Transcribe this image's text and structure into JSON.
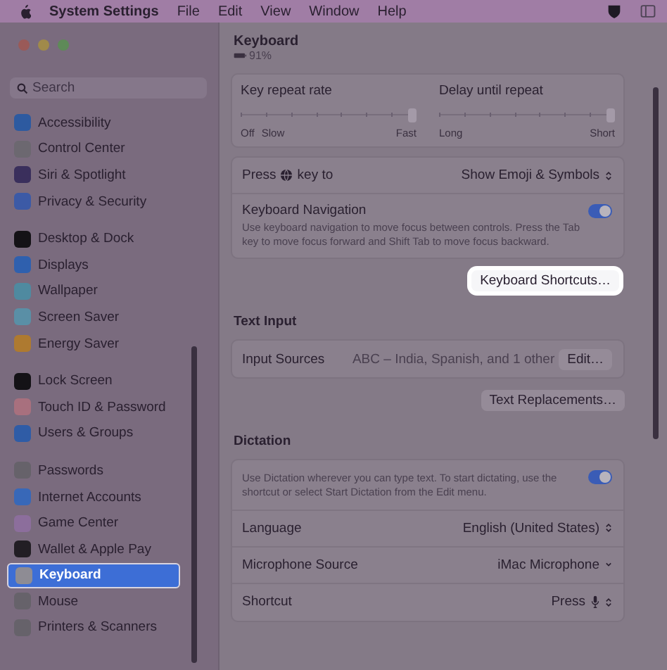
{
  "menu_bar": {
    "app_name": "System Settings",
    "menus": [
      "File",
      "Edit",
      "View",
      "Window",
      "Help"
    ]
  },
  "sidebar": {
    "search": {
      "placeholder": "Search"
    },
    "groups": [
      {
        "items": [
          {
            "label": "Accessibility",
            "color": "#2d5aa0",
            "selected": false
          },
          {
            "label": "Control Center",
            "color": "#6c6870",
            "selected": false
          },
          {
            "label": "Siri & Spotlight",
            "color": "#3a2f5c",
            "selected": false
          },
          {
            "label": "Privacy & Security",
            "color": "#3c5aa6",
            "selected": false
          }
        ]
      },
      {
        "items": [
          {
            "label": "Desktop & Dock",
            "color": "#141216",
            "selected": false
          },
          {
            "label": "Displays",
            "color": "#2f60ae",
            "selected": false
          },
          {
            "label": "Wallpaper",
            "color": "#4f8aa0",
            "selected": false
          },
          {
            "label": "Screen Saver",
            "color": "#5a8fa6",
            "selected": false
          },
          {
            "label": "Energy Saver",
            "color": "#ae7a30",
            "selected": false
          }
        ]
      },
      {
        "items": [
          {
            "label": "Lock Screen",
            "color": "#141216",
            "selected": false
          },
          {
            "label": "Touch ID & Password",
            "color": "#a8707e",
            "selected": false
          },
          {
            "label": "Users & Groups",
            "color": "#2f5ca6",
            "selected": false
          }
        ]
      },
      {
        "items": [
          {
            "label": "Passwords",
            "color": "#66626a",
            "selected": false
          },
          {
            "label": "Internet Accounts",
            "color": "#3868b8",
            "selected": false
          },
          {
            "label": "Game Center",
            "color": "#8c6e9c",
            "selected": false
          },
          {
            "label": "Wallet & Apple Pay",
            "color": "#221e24",
            "selected": false
          },
          {
            "label": "Keyboard",
            "color": "#8e8c94",
            "selected": true
          },
          {
            "label": "Mouse",
            "color": "#66626a",
            "selected": false
          },
          {
            "label": "Printers & Scanners",
            "color": "#66626a",
            "selected": false
          }
        ]
      }
    ]
  },
  "header": {
    "title": "Keyboard",
    "battery": "91%"
  },
  "sliders": [
    {
      "label": "Key repeat rate",
      "left_labels": [
        "Off",
        "Slow"
      ],
      "right_label": "Fast",
      "level": 1
    },
    {
      "label": "Delay until repeat",
      "left_labels": [
        "Long"
      ],
      "right_label": "Short",
      "level": 1
    }
  ],
  "sections": [
    {
      "rows": [
        {
          "kind": "keypress",
          "label": "Press",
          "label_end": "key to",
          "value": "Show Emoji & Symbols"
        },
        {
          "kind": "toggle",
          "label": "Keyboard Navigation",
          "description": "Use keyboard navigation to move focus between controls. Press the Tab key to move focus forward and Shift Tab to move focus backward.",
          "on": true
        }
      ],
      "buttons": [
        {
          "label": "Keyboard Shortcuts…",
          "highlighted": true
        }
      ]
    },
    {
      "title": "Text Input",
      "rows": [
        {
          "kind": "sources",
          "label": "Input Sources",
          "value": "ABC – India, Spanish, and 1 other",
          "button": "Edit…"
        }
      ],
      "buttons": [
        {
          "label": "Text Replacements…",
          "highlighted": false
        }
      ]
    },
    {
      "title": "Dictation",
      "rows": [
        {
          "kind": "toggle",
          "description": "Use Dictation wherever you can type text. To start dictating, use the shortcut or select Start Dictation from the Edit menu.",
          "on": true
        },
        {
          "kind": "popup",
          "label": "Language",
          "value": "English (United States)"
        },
        {
          "kind": "menu",
          "label": "Microphone Source",
          "value": "iMac Microphone"
        },
        {
          "kind": "shortcut",
          "label": "Shortcut",
          "value": "Press"
        }
      ]
    }
  ]
}
